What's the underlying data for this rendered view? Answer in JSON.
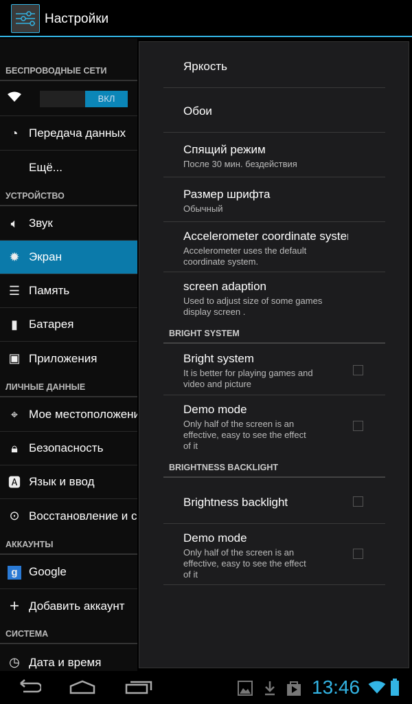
{
  "app": {
    "title": "Настройки",
    "icon": "settings-sliders-icon"
  },
  "sidebar": {
    "headers": [
      "БЕСПРОВОДНЫЕ СЕТИ",
      "УСТРОЙСТВО",
      "ЛИЧНЫЕ ДАННЫЕ",
      "АККАУНТЫ",
      "СИСТЕМА"
    ],
    "wifi": {
      "icon": "wifi-icon",
      "toggle": "ВКЛ"
    },
    "items": [
      {
        "label": "Передача данных",
        "icon": "data-usage-icon"
      },
      {
        "label": "Ещё...",
        "icon": ""
      },
      {
        "label": "Звук",
        "icon": "speaker-icon"
      },
      {
        "label": "Экран",
        "icon": "brightness-icon",
        "selected": true
      },
      {
        "label": "Память",
        "icon": "storage-icon"
      },
      {
        "label": "Батарея",
        "icon": "battery-icon"
      },
      {
        "label": "Приложения",
        "icon": "apps-icon"
      },
      {
        "label": "Мое местоположение",
        "icon": "location-icon"
      },
      {
        "label": "Безопасность",
        "icon": "lock-icon"
      },
      {
        "label": "Язык и ввод",
        "icon": "language-icon"
      },
      {
        "label": "Восстановление и сброс",
        "icon": "backup-icon"
      },
      {
        "label": "Google",
        "icon": "google-icon"
      },
      {
        "label": "Добавить аккаунт",
        "icon": "plus-icon"
      },
      {
        "label": "Дата и время",
        "icon": "clock-icon"
      }
    ]
  },
  "main": {
    "items": [
      {
        "title": "Яркость"
      },
      {
        "title": "Обои"
      },
      {
        "title": "Спящий режим",
        "summary": "После 30 мин. бездействия"
      },
      {
        "title": "Размер шрифта",
        "summary": "Обычный"
      },
      {
        "title": "Accelerometer coordinate system",
        "summary": "Accelerometer uses the default coordinate system."
      },
      {
        "title": "screen adaption",
        "summary": "Used to adjust size of some games display screen ."
      }
    ],
    "sections": [
      {
        "header": "BRIGHT SYSTEM",
        "items": [
          {
            "title": "Bright system",
            "summary": "It is better for playing games and video and picture",
            "checked": false
          },
          {
            "title": "Demo mode",
            "summary": "Only half of the screen is an effective, easy to see the effect of it",
            "checked": false
          }
        ]
      },
      {
        "header": "BRIGHTNESS BACKLIGHT",
        "items": [
          {
            "title": "Brightness backlight",
            "checked": false
          },
          {
            "title": "Demo mode",
            "summary": "Only half of the screen is an effective, easy to see the effect of it",
            "checked": false
          }
        ]
      }
    ]
  },
  "statusbar": {
    "time": "13:46",
    "accent": "#33b5e5",
    "icons": [
      "gallery-icon",
      "download-icon",
      "play-store-icon",
      "wifi-icon",
      "battery-icon"
    ]
  },
  "navbar": {
    "icons": [
      "back-icon",
      "home-icon",
      "recent-apps-icon"
    ]
  }
}
